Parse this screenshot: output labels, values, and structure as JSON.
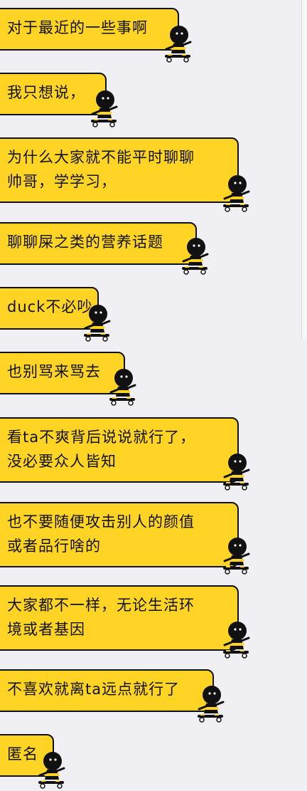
{
  "messages": [
    {
      "lines": [
        "对于最近的一些事啊"
      ]
    },
    {
      "lines": [
        "我只想说，"
      ]
    },
    {
      "lines": [
        "为什么大家就不能平时聊聊",
        "帅哥，学学习，"
      ]
    },
    {
      "lines": [
        "聊聊屎之类的营养话题"
      ]
    },
    {
      "lines": [
        "duck不必吵"
      ]
    },
    {
      "lines": [
        "也别骂来骂去"
      ]
    },
    {
      "lines": [
        "看ta不爽背后说说就行了，",
        "没必要众人皆知"
      ]
    },
    {
      "lines": [
        "也不要随便攻击别人的颜值",
        "或者品行啥的"
      ]
    },
    {
      "lines": [
        "大家都不一样，无论生活环",
        "境或者基因"
      ]
    },
    {
      "lines": [
        "不喜欢就离ta远点就行了"
      ]
    },
    {
      "lines": [
        "匿名"
      ]
    }
  ],
  "sticker_icon": "skateboard-character-icon",
  "bubble_color": "#ffd424"
}
